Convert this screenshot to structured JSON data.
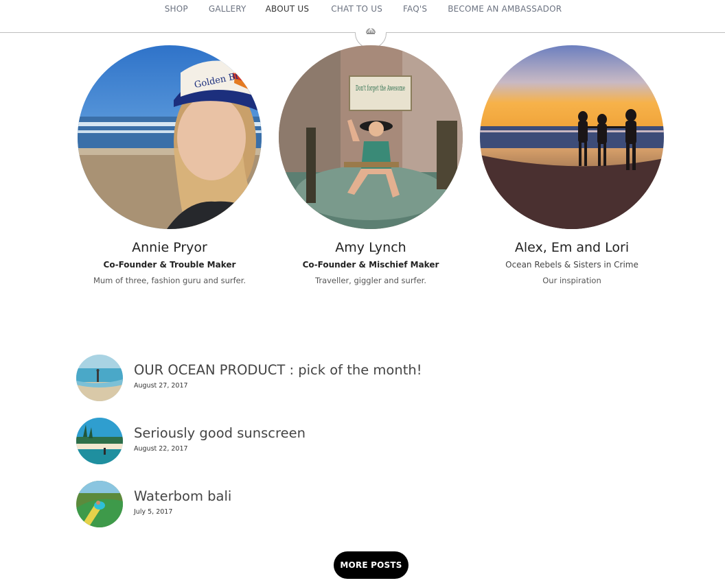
{
  "nav": {
    "items": [
      {
        "label": "SHOP"
      },
      {
        "label": "GALLERY"
      },
      {
        "label": "ABOUT US"
      },
      {
        "label": "CHAT TO US"
      },
      {
        "label": "FAQ'S"
      },
      {
        "label": "BECOME AN AMBASSADOR"
      }
    ],
    "active": "ABOUT US"
  },
  "team": [
    {
      "name": "Annie Pryor",
      "role": "Co-Founder & Trouble Maker",
      "desc": "Mum of three, fashion guru and surfer."
    },
    {
      "name": "Amy Lynch",
      "role": "Co-Founder & Mischief Maker",
      "desc": "Traveller, giggler and surfer."
    },
    {
      "name": "Alex, Em and Lori",
      "role": "Ocean Rebels & Sisters in Crime",
      "desc": "Our inspiration"
    }
  ],
  "posts": [
    {
      "title": "OUR OCEAN PRODUCT : pick of the month!",
      "date": "August 27, 2017"
    },
    {
      "title": "Seriously good sunscreen",
      "date": "August 22, 2017"
    },
    {
      "title": "Waterbom bali",
      "date": "July 5, 2017"
    }
  ],
  "more_posts_label": "MORE POSTS",
  "photo_texts": {
    "cap_text": "Golden Breed",
    "sign_text": "Don't forget the Awesome"
  }
}
